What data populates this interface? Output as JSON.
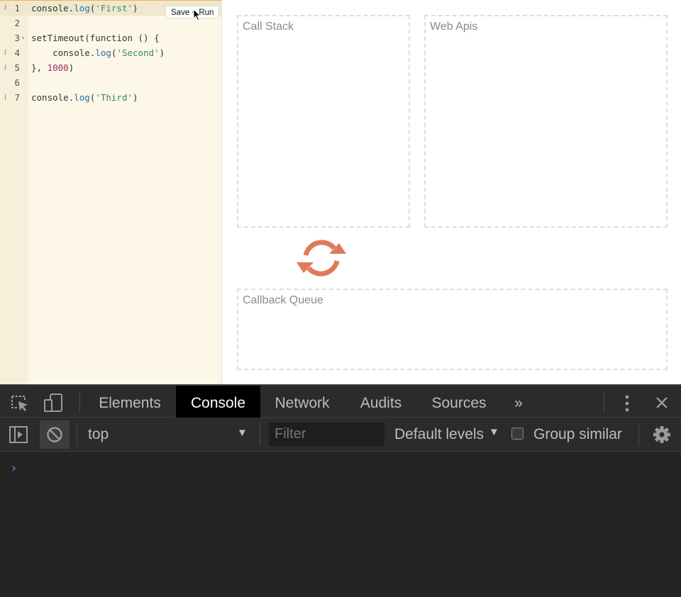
{
  "editor": {
    "save_run_label": "Save + Run",
    "lines": [
      {
        "number": "1",
        "info": "i",
        "fold": ""
      },
      {
        "number": "2",
        "info": "",
        "fold": ""
      },
      {
        "number": "3",
        "info": "",
        "fold": "▾"
      },
      {
        "number": "4",
        "info": "i",
        "fold": ""
      },
      {
        "number": "5",
        "info": "i",
        "fold": ""
      },
      {
        "number": "6",
        "info": "",
        "fold": ""
      },
      {
        "number": "7",
        "info": "i",
        "fold": ""
      }
    ],
    "code": {
      "l1": {
        "obj": "console",
        "dot": ".",
        "fn": "log",
        "open": "(",
        "str": "'First'",
        "close": ")"
      },
      "l3": {
        "text": "setTimeout(function () {"
      },
      "l4": {
        "indent": "    ",
        "obj": "console",
        "dot": ".",
        "fn": "log",
        "open": "(",
        "str": "'Second'",
        "close": ")"
      },
      "l5": {
        "pre": "}, ",
        "num": "1000",
        "post": ")"
      },
      "l7": {
        "obj": "console",
        "dot": ".",
        "fn": "log",
        "open": "(",
        "str": "'Third'",
        "close": ")"
      }
    }
  },
  "visualizer": {
    "call_stack": "Call Stack",
    "web_apis": "Web Apis",
    "callback_queue": "Callback Queue",
    "loop_icon": "refresh-cycle-icon",
    "accent_color": "#e07b58"
  },
  "devtools": {
    "tabs": [
      "Elements",
      "Console",
      "Network",
      "Audits",
      "Sources"
    ],
    "active_tab": "Console",
    "more_tabs": "»",
    "context": "top",
    "filter_placeholder": "Filter",
    "levels": "Default levels",
    "group_similar": "Group similar",
    "prompt": "›"
  }
}
